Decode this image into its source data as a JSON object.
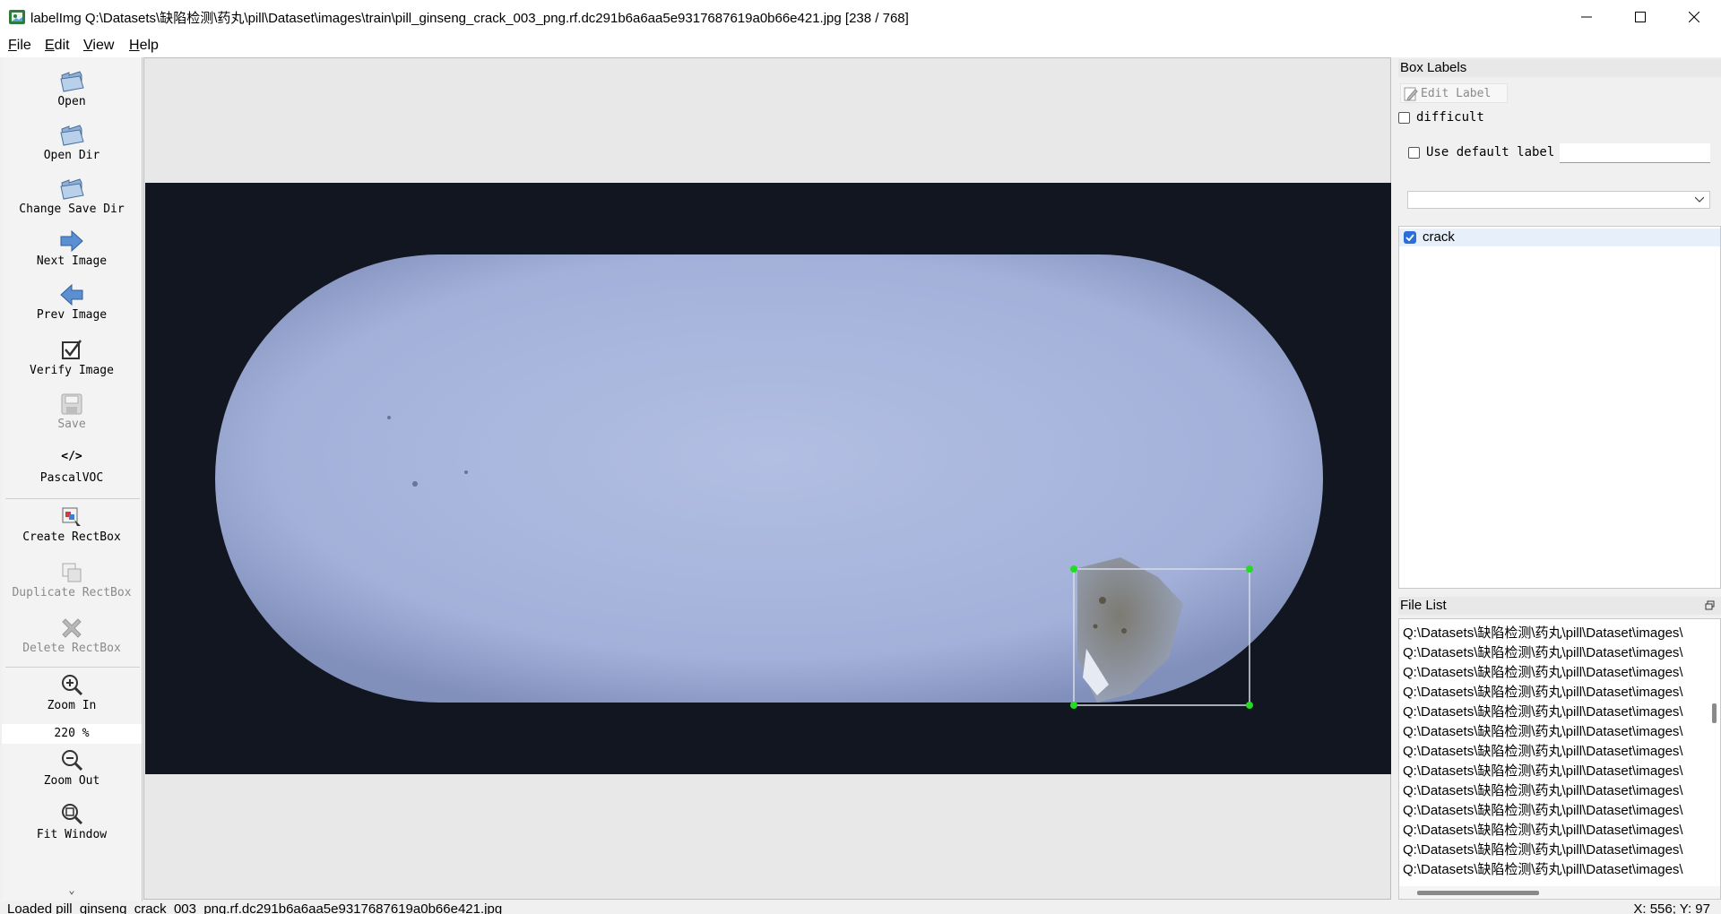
{
  "window": {
    "title": "labelImg Q:\\Datasets\\缺陷检测\\药丸\\pill\\Dataset\\images\\train\\pill_ginseng_crack_003_png.rf.dc291b6a6aa5e9317687619a0b66e421.jpg [238 / 768]"
  },
  "menu": [
    {
      "label": "File",
      "key": "F",
      "rest": "ile"
    },
    {
      "label": "Edit",
      "key": "E",
      "rest": "dit"
    },
    {
      "label": "View",
      "key": "V",
      "rest": "iew"
    },
    {
      "label": "Help",
      "key": "H",
      "rest": "elp"
    }
  ],
  "toolbar": {
    "open": "Open",
    "open_dir": "Open Dir",
    "change_save_dir": "Change Save Dir",
    "next_image": "Next Image",
    "prev_image": "Prev Image",
    "verify_image": "Verify Image",
    "save": "Save",
    "format": "PascalVOC",
    "format_icon": "</>",
    "create_rectbox": "Create RectBox",
    "duplicate_rectbox": "Duplicate RectBox",
    "delete_rectbox": "Delete RectBox",
    "zoom_in": "Zoom In",
    "zoom_value": "220 %",
    "zoom_out": "Zoom Out",
    "fit_window": "Fit Window",
    "more": "⌄"
  },
  "box_labels": {
    "title": "Box Labels",
    "edit_label": "Edit Label",
    "difficult": "difficult",
    "difficult_checked": false,
    "use_default_label": "Use default label",
    "use_default_checked": false,
    "default_label_value": "",
    "labels": [
      {
        "text": "crack",
        "checked": true
      }
    ]
  },
  "file_list": {
    "title": "File List",
    "items": [
      "Q:\\Datasets\\缺陷检测\\药丸\\pill\\Dataset\\images\\",
      "Q:\\Datasets\\缺陷检测\\药丸\\pill\\Dataset\\images\\",
      "Q:\\Datasets\\缺陷检测\\药丸\\pill\\Dataset\\images\\",
      "Q:\\Datasets\\缺陷检测\\药丸\\pill\\Dataset\\images\\",
      "Q:\\Datasets\\缺陷检测\\药丸\\pill\\Dataset\\images\\",
      "Q:\\Datasets\\缺陷检测\\药丸\\pill\\Dataset\\images\\",
      "Q:\\Datasets\\缺陷检测\\药丸\\pill\\Dataset\\images\\",
      "Q:\\Datasets\\缺陷检测\\药丸\\pill\\Dataset\\images\\",
      "Q:\\Datasets\\缺陷检测\\药丸\\pill\\Dataset\\images\\",
      "Q:\\Datasets\\缺陷检测\\药丸\\pill\\Dataset\\images\\",
      "Q:\\Datasets\\缺陷检测\\药丸\\pill\\Dataset\\images\\",
      "Q:\\Datasets\\缺陷检测\\药丸\\pill\\Dataset\\images\\",
      "Q:\\Datasets\\缺陷检测\\药丸\\pill\\Dataset\\images\\"
    ]
  },
  "status": {
    "message": "Loaded pill_ginseng_crack_003_png.rf.dc291b6a6aa5e9317687619a0b66e421.jpg",
    "coords": "X: 556; Y: 97"
  },
  "colors": {
    "box_handle": "#22dd22",
    "box_stroke": "#d8dce8",
    "pill": "#a9b6dc",
    "background": "#121620",
    "accent": "#2b6fd6"
  }
}
